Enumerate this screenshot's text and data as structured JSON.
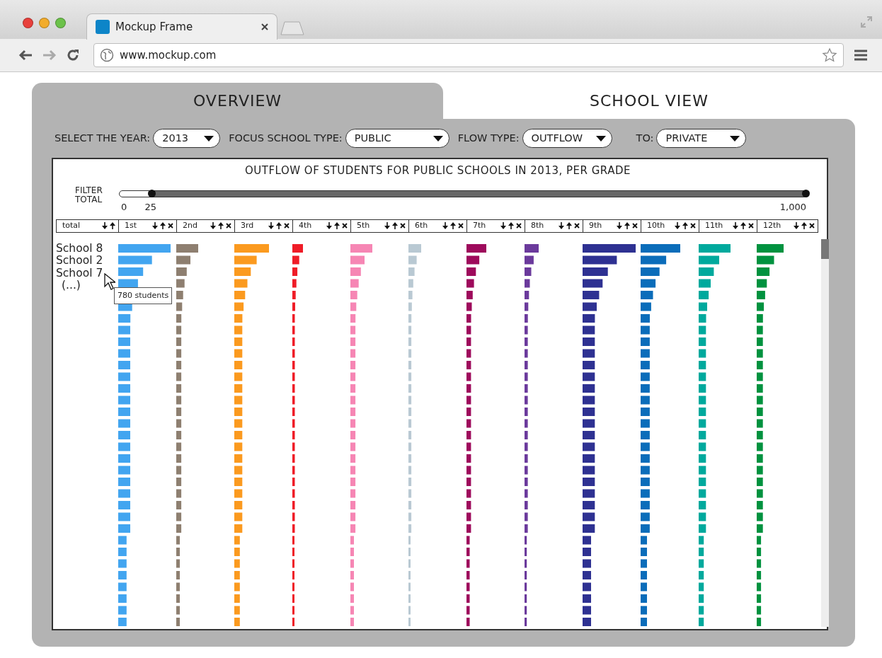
{
  "browser": {
    "tab_title": "Mockup Frame",
    "url": "www.mockup.com"
  },
  "tabs": [
    {
      "label": "OVERVIEW",
      "selected": true
    },
    {
      "label": "SCHOOL VIEW",
      "selected": false
    }
  ],
  "filters": [
    {
      "label": "SELECT THE YEAR:",
      "value": "2013"
    },
    {
      "label": "FOCUS SCHOOL TYPE:",
      "value": "PUBLIC"
    },
    {
      "label": "FLOW TYPE:",
      "value": "OUTFLOW"
    },
    {
      "label": "TO:",
      "value": "PRIVATE"
    }
  ],
  "chart": {
    "title": "OUTFLOW OF STUDENTS FOR PUBLIC SCHOOLS IN 2013, PER GRADE",
    "slider": {
      "label": "FILTER TOTAL",
      "min_label": "0",
      "thumbs": [
        {
          "label": "25",
          "level": 0.047
        },
        {
          "label": "1,000",
          "level": 1
        }
      ]
    },
    "columns": [
      {
        "label": "total",
        "removable": false
      },
      {
        "label": "1st",
        "removable": true,
        "color": "#42a5f0"
      },
      {
        "label": "2nd",
        "removable": true,
        "color": "#8e7f70"
      },
      {
        "label": "3rd",
        "removable": true,
        "color": "#fb9a1f"
      },
      {
        "label": "4th",
        "removable": true,
        "color": "#ef1c27"
      },
      {
        "label": "5th",
        "removable": true,
        "color": "#f686b4"
      },
      {
        "label": "6th",
        "removable": true,
        "color": "#b9c9d3"
      },
      {
        "label": "7th",
        "removable": true,
        "color": "#9e0a5c"
      },
      {
        "label": "8th",
        "removable": true,
        "color": "#6b3a9c"
      },
      {
        "label": "9th",
        "removable": true,
        "color": "#2e3192"
      },
      {
        "label": "10th",
        "removable": true,
        "color": "#0b6dba"
      },
      {
        "label": "11th",
        "removable": true,
        "color": "#00a99d"
      },
      {
        "label": "12th",
        "removable": true,
        "color": "#00923f"
      }
    ],
    "schools": [
      "School 8",
      "School 2",
      "School 7",
      "(...)"
    ],
    "tooltip": "780 students"
  }
}
